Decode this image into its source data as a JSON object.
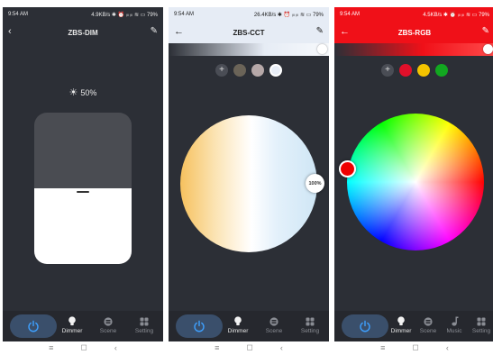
{
  "screens": [
    {
      "status": {
        "time": "9:54 AM",
        "right": "4.9KB/s ✱ ⏰ ᵢₗₗ ᵢₗₗ ≋ ▭ 79%"
      },
      "title": "ZBS-DIM",
      "brightness_label": "50%",
      "brightness_level": 0.5,
      "nav": [
        "Dimmer",
        "Scene",
        "Setting"
      ]
    },
    {
      "status": {
        "time": "9:54 AM",
        "right": "26.4KB/s ✱ ⏰ ᵢₗₗ ᵢₗₗ ≋ ▭ 79%"
      },
      "title": "ZBS-CCT",
      "wheel_label": "100%",
      "chips": [
        "#6b6458",
        "#b6a8a8",
        "#e8eef7"
      ],
      "nav": [
        "Dimmer",
        "Scene",
        "Setting"
      ]
    },
    {
      "status": {
        "time": "9:54 AM",
        "right": "4.5KB/s ✱ ⏰ ᵢₗₗ ᵢₗₗ ≋ ▭ 79%"
      },
      "title": "ZBS-RGB",
      "chips": [
        "#e0102a",
        "#f4c400",
        "#12a820"
      ],
      "nav": [
        "Dimmer",
        "Scene",
        "Music",
        "Setting"
      ]
    }
  ],
  "colors": {
    "dark_bg": "#2c2f36",
    "accent": "#2f8fff",
    "rgb_header": "#f01018"
  },
  "sysnav": [
    "≡",
    "◻",
    "‹"
  ]
}
